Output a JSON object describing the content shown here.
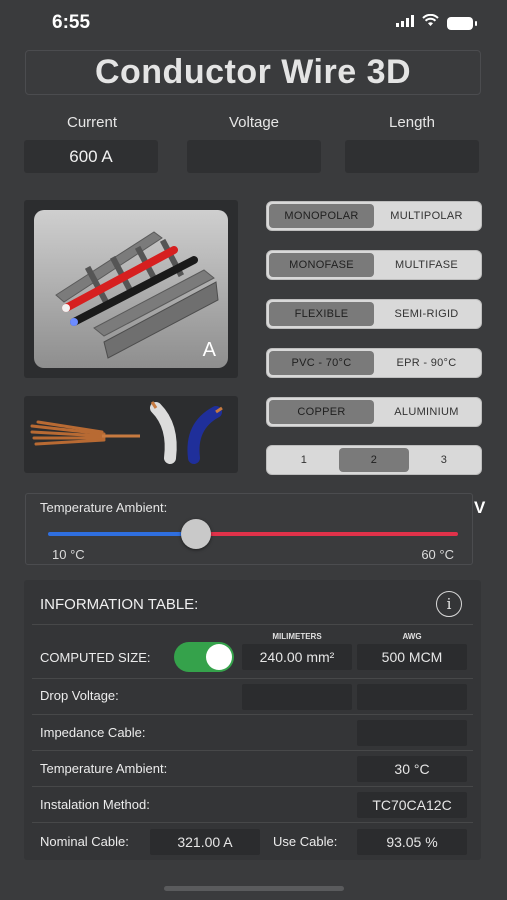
{
  "status": {
    "time": "6:55"
  },
  "app": {
    "title": "Conductor Wire 3D"
  },
  "fields": {
    "current_label": "Current",
    "current_value": "600 A",
    "voltage_label": "Voltage",
    "voltage_value": "",
    "length_label": "Length",
    "length_value": ""
  },
  "image": {
    "badge": "A"
  },
  "segments": [
    {
      "options": [
        "MONOPOLAR",
        "MULTIPOLAR"
      ],
      "selected": 0
    },
    {
      "options": [
        "MONOFASE",
        "MULTIFASE"
      ],
      "selected": 0
    },
    {
      "options": [
        "FLEXIBLE",
        "SEMI-RIGID"
      ],
      "selected": 0
    },
    {
      "options": [
        "PVC - 70°C",
        "EPR - 90°C"
      ],
      "selected": 0
    },
    {
      "options": [
        "COPPER",
        "ALUMINIUM"
      ],
      "selected": 0
    },
    {
      "options": [
        "1",
        "2",
        "3"
      ],
      "selected": 1
    }
  ],
  "slider": {
    "label": "Temperature Ambient:",
    "min_label": "10 °C",
    "max_label": "60 °C",
    "level_fraction": 0.36,
    "side_letter": "V",
    "left_color": "#2f6fe0",
    "right_color": "#e0324a"
  },
  "info": {
    "title": "INFORMATION TABLE:",
    "col_mm": "MILIMETERS",
    "col_awg": "AWG",
    "computed_label": "COMPUTED SIZE:",
    "computed_mm": "240.00 mm²",
    "computed_awg": "500 MCM",
    "toggle_on": true,
    "toggle_color": "#35a24b",
    "drop_label": "Drop Voltage:",
    "impedance_label": "Impedance Cable:",
    "temp_label": "Temperature Ambient:",
    "temp_value": "30 °C",
    "method_label": "Instalation Method:",
    "method_value": "TC70CA12C",
    "nominal_label": "Nominal Cable:",
    "nominal_value": "321.00 A",
    "use_label": "Use Cable:",
    "use_value": "93.05 %"
  }
}
